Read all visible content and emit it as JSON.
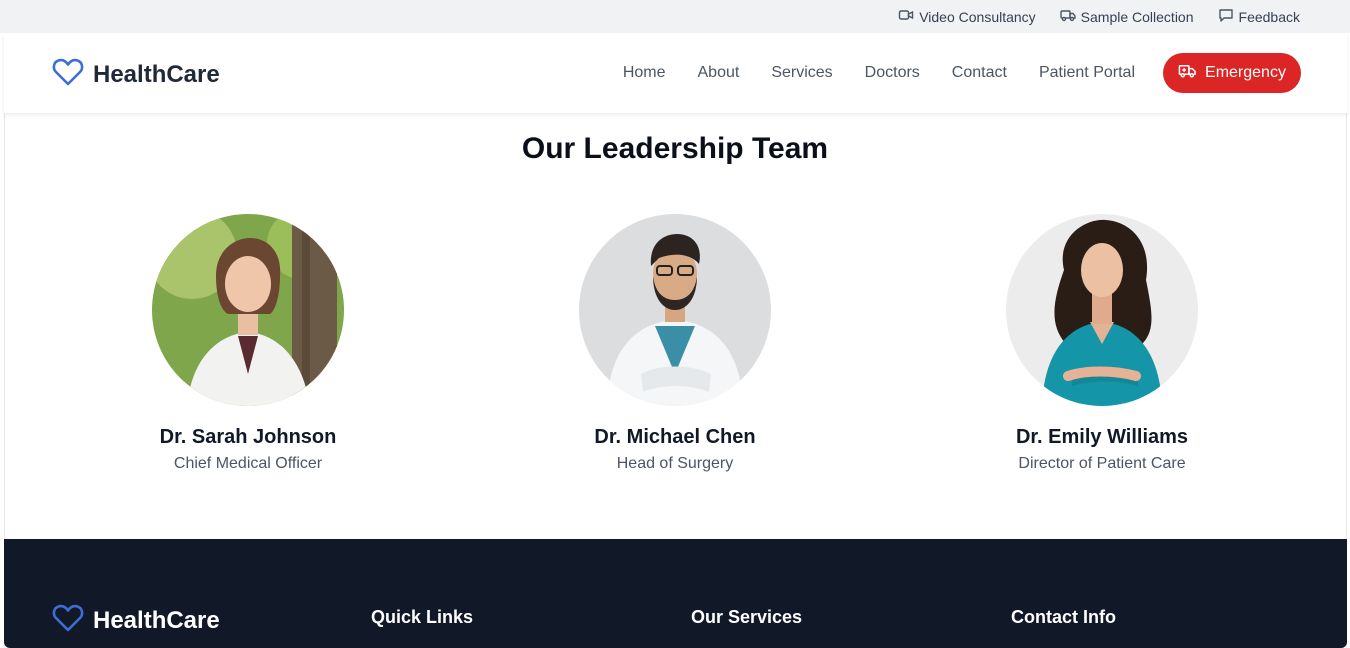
{
  "topbar": {
    "links": [
      {
        "label": "Video Consultancy",
        "icon": "video-camera-icon"
      },
      {
        "label": "Sample Collection",
        "icon": "truck-icon"
      },
      {
        "label": "Feedback",
        "icon": "chat-bubble-icon"
      }
    ]
  },
  "header": {
    "brand": "HealthCare",
    "brand_icon": "heart-icon",
    "nav": [
      "Home",
      "About",
      "Services",
      "Doctors",
      "Contact",
      "Patient Portal"
    ],
    "emergency_label": "Emergency",
    "emergency_icon": "ambulance-icon"
  },
  "colors": {
    "brand_blue": "#3b6fd4",
    "emergency_red": "#dc2626",
    "footer_bg": "#111827",
    "topbar_bg": "#f1f2f4"
  },
  "leadership": {
    "title": "Our Leadership Team",
    "members": [
      {
        "name": "Dr. Sarah Johnson",
        "role": "Chief Medical Officer"
      },
      {
        "name": "Dr. Michael Chen",
        "role": "Head of Surgery"
      },
      {
        "name": "Dr. Emily Williams",
        "role": "Director of Patient Care"
      }
    ]
  },
  "footer": {
    "brand": "HealthCare",
    "headings": [
      "Quick Links",
      "Our Services",
      "Contact Info"
    ]
  }
}
